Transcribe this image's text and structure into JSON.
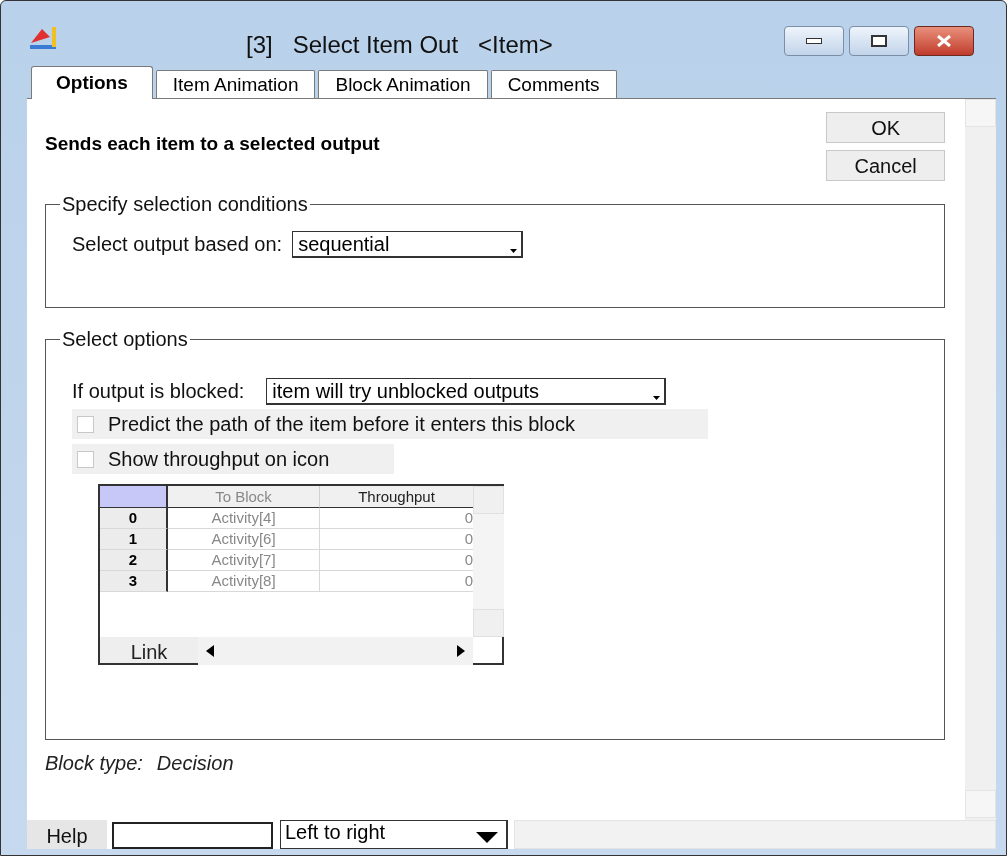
{
  "window": {
    "title": "[3]   Select Item Out   <Item>"
  },
  "tabs": [
    {
      "label": "Options",
      "selected": true
    },
    {
      "label": "Item Animation",
      "selected": false
    },
    {
      "label": "Block Animation",
      "selected": false
    },
    {
      "label": "Comments",
      "selected": false
    }
  ],
  "description": "Sends each item to a selected output",
  "buttons": [
    "OK",
    "Cancel"
  ],
  "selection_conditions": {
    "title": "Specify selection conditions",
    "label": "Select output based on:",
    "value": "sequential"
  },
  "select_options": {
    "title": "Select options",
    "label": "If output is blocked:",
    "value": "item will try unblocked outputs",
    "checkboxes": [
      {
        "label": "Predict the path of the item before it enters this block",
        "checked": false
      },
      {
        "label": "Show throughput on icon",
        "checked": false
      }
    ],
    "table": {
      "columns": [
        "To Block",
        "Throughput"
      ],
      "rows": [
        {
          "index": "0",
          "to_block": "Activity[4]",
          "throughput": "0"
        },
        {
          "index": "1",
          "to_block": "Activity[6]",
          "throughput": "0"
        },
        {
          "index": "2",
          "to_block": "Activity[7]",
          "throughput": "0"
        },
        {
          "index": "3",
          "to_block": "Activity[8]",
          "throughput": "0"
        }
      ],
      "link_button": "Link"
    }
  },
  "block_type": {
    "label": "Block type:",
    "value": "Decision"
  },
  "bottom_bar": {
    "help_button": "Help",
    "direction": "Left to right"
  }
}
